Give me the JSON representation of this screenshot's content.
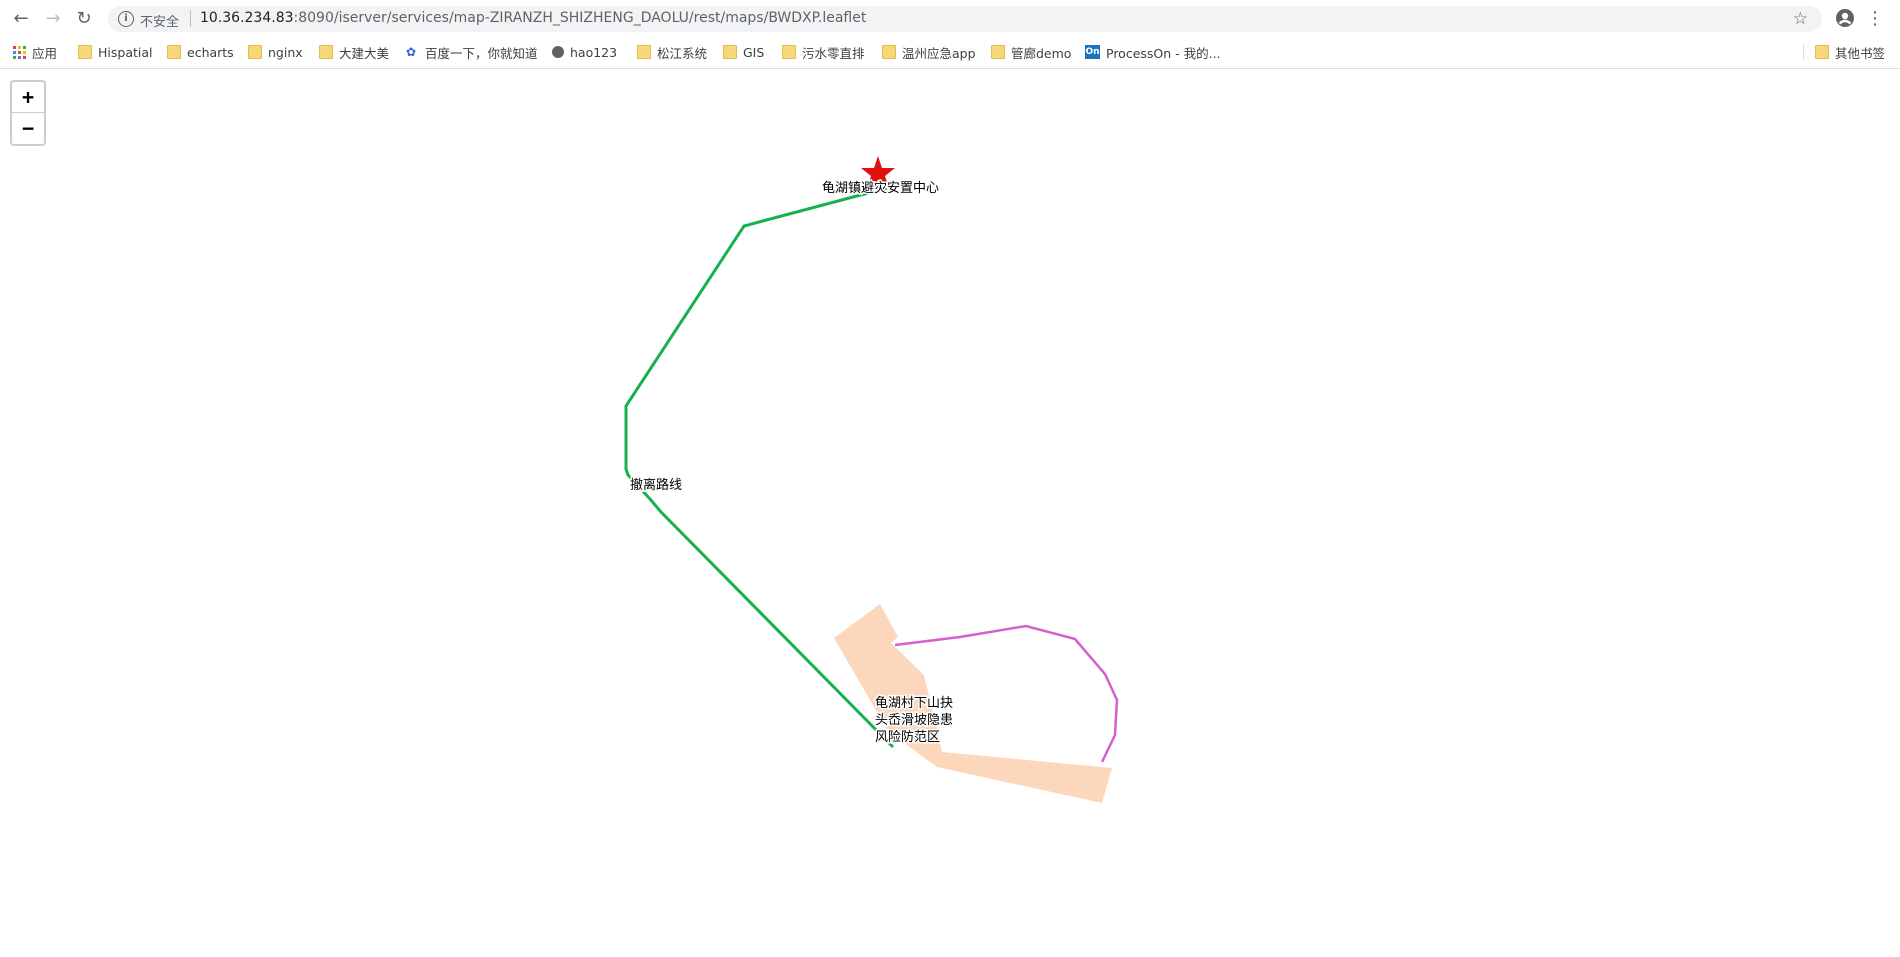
{
  "browser": {
    "back_icon": "arrow-left-icon",
    "forward_icon": "arrow-right-icon",
    "reload_icon": "reload-icon",
    "security_label": "不安全",
    "url_host": "10.36.234.83",
    "url_rest": ":8090/iserver/services/map-ZIRANZH_SHIZHENG_DAOLU/rest/maps/BWDXP.leaflet",
    "bookmark_star_icon": "star-outline-icon",
    "profile_icon": "account-circle-icon",
    "menu_icon": "kebab-menu-icon"
  },
  "bookmarks": {
    "items": [
      {
        "label": "应用",
        "icon": "apps-grid-icon"
      },
      {
        "label": "Hispatial",
        "icon": "folder-icon"
      },
      {
        "label": "echarts",
        "icon": "folder-icon"
      },
      {
        "label": "nginx",
        "icon": "folder-icon"
      },
      {
        "label": "大建大美",
        "icon": "folder-icon"
      },
      {
        "label": "百度一下，你就知道",
        "icon": "baidu-paw-icon"
      },
      {
        "label": "hao123",
        "icon": "globe-icon"
      },
      {
        "label": "松江系统",
        "icon": "folder-icon"
      },
      {
        "label": "GIS",
        "icon": "folder-icon"
      },
      {
        "label": "污水零直排",
        "icon": "folder-icon"
      },
      {
        "label": "温州应急app",
        "icon": "folder-icon"
      },
      {
        "label": "管廊demo",
        "icon": "folder-icon"
      },
      {
        "label": "ProcessOn - 我的...",
        "icon": "processon-icon"
      }
    ],
    "other_label": "其他书签"
  },
  "map": {
    "zoom_in_label": "+",
    "zoom_out_label": "−",
    "center_marker_icon": "red-star-icon",
    "center_label": "龟湖镇避灾安置中心",
    "route_label": "撤离路线",
    "zone_label_lines": [
      "龟湖村下山抉",
      "头岙滑坡隐患",
      "风险防范区"
    ],
    "colors": {
      "route": "#17b04f",
      "boundary": "#d45fd0",
      "zone_fill": "#fcd7bc",
      "marker": "#e01010"
    }
  }
}
